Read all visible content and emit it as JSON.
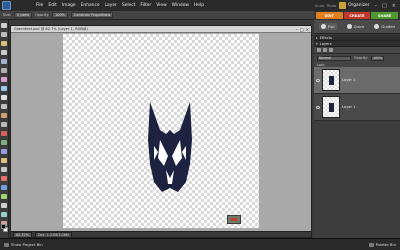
{
  "menubar": {
    "items": [
      "File",
      "Edit",
      "Image",
      "Enhance",
      "Layer",
      "Select",
      "Filter",
      "View",
      "Window",
      "Help"
    ],
    "right_links": [
      "Undo",
      "Redo"
    ],
    "organizer_label": "Organizer",
    "window_controls": [
      "–",
      "□",
      "×"
    ]
  },
  "options": {
    "size_label": "Size:",
    "size_value": "0 pxels",
    "opacity_label": "Opacity:",
    "opacity_value": "100%",
    "mode_value": "Constrain Proportions"
  },
  "modes": {
    "edit": "EDIT",
    "create": "CREATE",
    "share": "SHARE"
  },
  "edit_tabs": [
    "Full",
    "Quick",
    "Guided"
  ],
  "document": {
    "title": "Greenfeet.psd @ 62.7% (Layer 1, RGB/8)",
    "zoom": "62.72%",
    "info": "Doc: 1.21M/3.06M"
  },
  "panels": {
    "effects_title": "Effects",
    "layers_title": "Layers",
    "blend_mode": "Normal",
    "opacity_label": "Opacity:",
    "opacity_value": "100%",
    "lock_label": "Lock:",
    "layers": [
      {
        "name": "Layer 1",
        "selected": true
      },
      {
        "name": "Layer 1",
        "selected": false
      }
    ]
  },
  "bottom": {
    "project_bin": "Show Project Bin",
    "palette_bin": "Palette Bin"
  },
  "colors": {
    "edit_tab": "#e07f1f",
    "create_tab": "#c0392b",
    "share_tab": "#4f9a2f",
    "artwork": "#1c2240"
  },
  "tools": [
    "move-icon",
    "zoom-icon",
    "hand-icon",
    "eyedropper-icon",
    "marquee-icon",
    "lasso-icon",
    "magic-wand-icon",
    "selection-brush-icon",
    "text-icon",
    "crop-icon",
    "cookie-cutter-icon",
    "straighten-icon",
    "red-eye-icon",
    "healing-icon",
    "clone-stamp-icon",
    "eraser-icon",
    "pencil-icon",
    "brush-icon",
    "paint-bucket-icon",
    "gradient-icon",
    "shape-icon",
    "blur-icon",
    "sponge-icon"
  ]
}
